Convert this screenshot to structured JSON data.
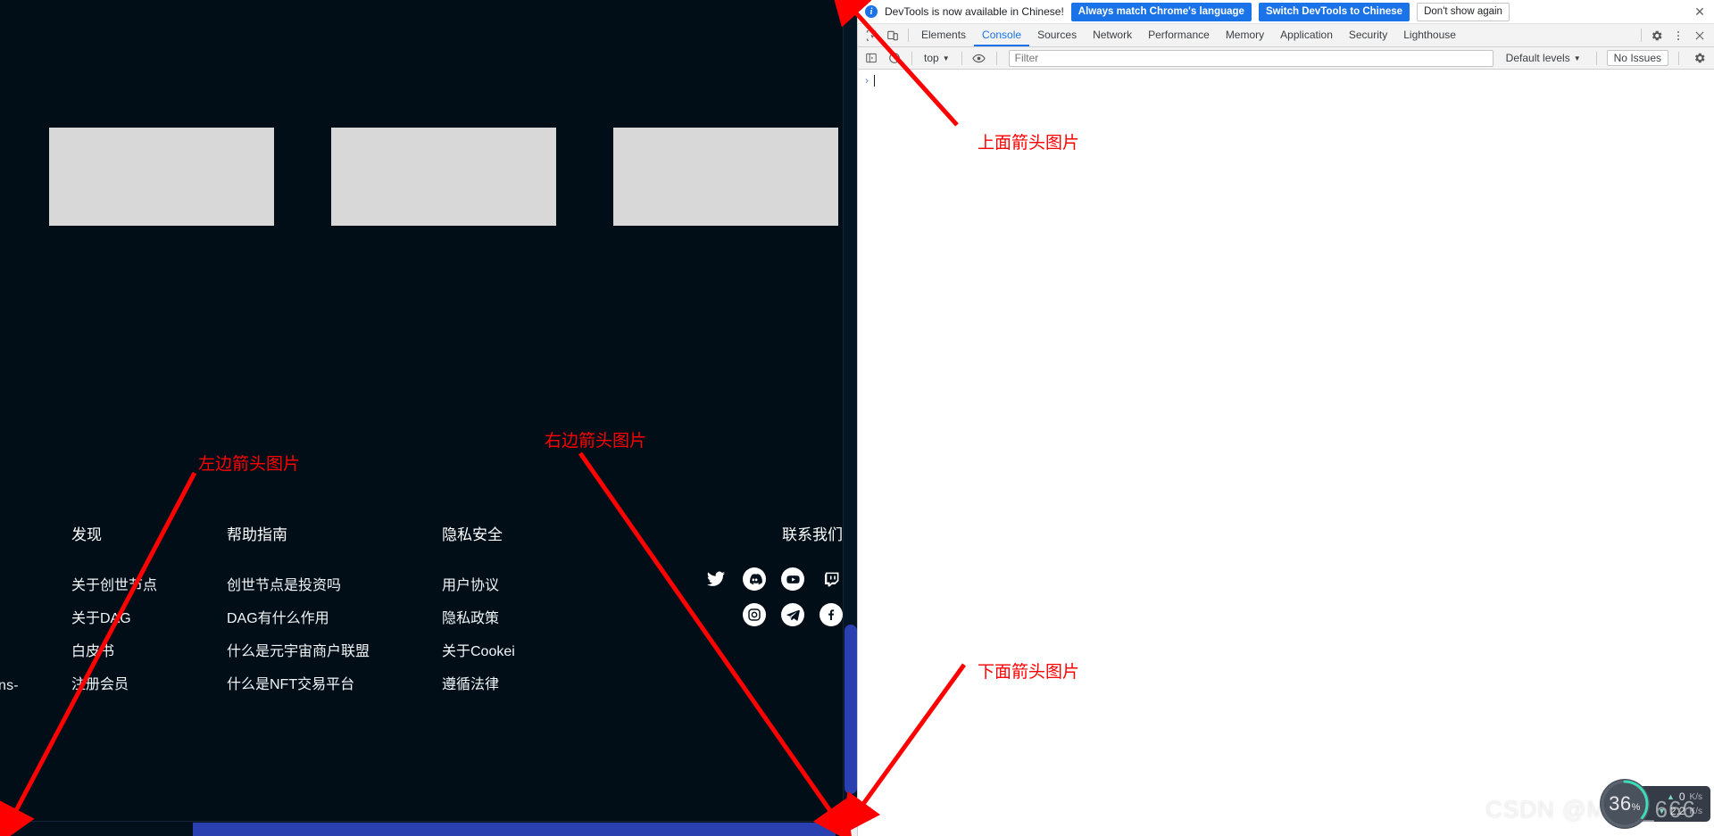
{
  "webpage": {
    "background_color": "#010e18",
    "placeholder_cards": [
      {
        "label": "image-placeholder-1"
      },
      {
        "label": "image-placeholder-2"
      },
      {
        "label": "image-placeholder-3"
      }
    ],
    "stray_text": "ns-",
    "footer": {
      "columns": [
        {
          "title": "发现",
          "links": [
            "关于创世节点",
            "关于DAG",
            "白皮书",
            "注册会员"
          ]
        },
        {
          "title": "帮助指南",
          "links": [
            "创世节点是投资吗",
            "DAG有什么作用",
            "什么是元宇宙商户联盟",
            "什么是NFT交易平台"
          ]
        },
        {
          "title": "隐私安全",
          "links": [
            "用户协议",
            "隐私政策",
            "关于Cookei",
            "遵循法律"
          ]
        },
        {
          "title": "联系我们",
          "social": [
            [
              "twitter-icon",
              "discord-icon",
              "youtube-icon",
              "twitch-icon"
            ],
            [
              "instagram-icon",
              "telegram-icon",
              "facebook-icon"
            ]
          ]
        }
      ]
    }
  },
  "devtools": {
    "infobar": {
      "icon": "info-icon",
      "message": "DevTools is now available in Chinese!",
      "buttons": [
        {
          "label": "Always match Chrome's language",
          "style": "primary"
        },
        {
          "label": "Switch DevTools to Chinese",
          "style": "primary"
        },
        {
          "label": "Don't show again",
          "style": "secondary"
        }
      ],
      "close_label": "✕"
    },
    "tabbar": {
      "inspect_icon": "inspect-element-icon",
      "device_icon": "device-toolbar-icon",
      "tabs": [
        {
          "label": "Elements",
          "active": false
        },
        {
          "label": "Console",
          "active": true
        },
        {
          "label": "Sources",
          "active": false
        },
        {
          "label": "Network",
          "active": false
        },
        {
          "label": "Performance",
          "active": false
        },
        {
          "label": "Memory",
          "active": false
        },
        {
          "label": "Application",
          "active": false
        },
        {
          "label": "Security",
          "active": false
        },
        {
          "label": "Lighthouse",
          "active": false
        }
      ],
      "settings_icon": "gear-icon",
      "more_icon": "kebab-menu-icon",
      "close_icon": "close-icon"
    },
    "console_toolbar": {
      "sidebar_icon": "console-sidebar-icon",
      "clear_icon": "clear-console-icon",
      "context_label": "top",
      "eye_icon": "live-expression-icon",
      "filter_placeholder": "Filter",
      "filter_value": "",
      "levels_label": "Default levels",
      "issues_label": "No Issues",
      "settings_icon": "gear-icon"
    },
    "console": {
      "prompt_chevron": "›",
      "prompt_value": ""
    }
  },
  "annotations": [
    {
      "id": "top",
      "text": "上面箭头图片",
      "color": "#fe0000"
    },
    {
      "id": "left",
      "text": "左边箭头图片",
      "color": "#fe0000"
    },
    {
      "id": "right",
      "text": "右边箭头图片",
      "color": "#fe0000"
    },
    {
      "id": "bottom",
      "text": "下面箭头图片",
      "color": "#fe0000"
    }
  ],
  "perf_widget": {
    "cpu_percent": "36",
    "percent_unit": "%",
    "upload_value": "0",
    "upload_unit": "K/s",
    "download_value": "2.2",
    "download_unit": "K/s"
  },
  "watermark": {
    "text": "CSDN @MFG_666"
  }
}
